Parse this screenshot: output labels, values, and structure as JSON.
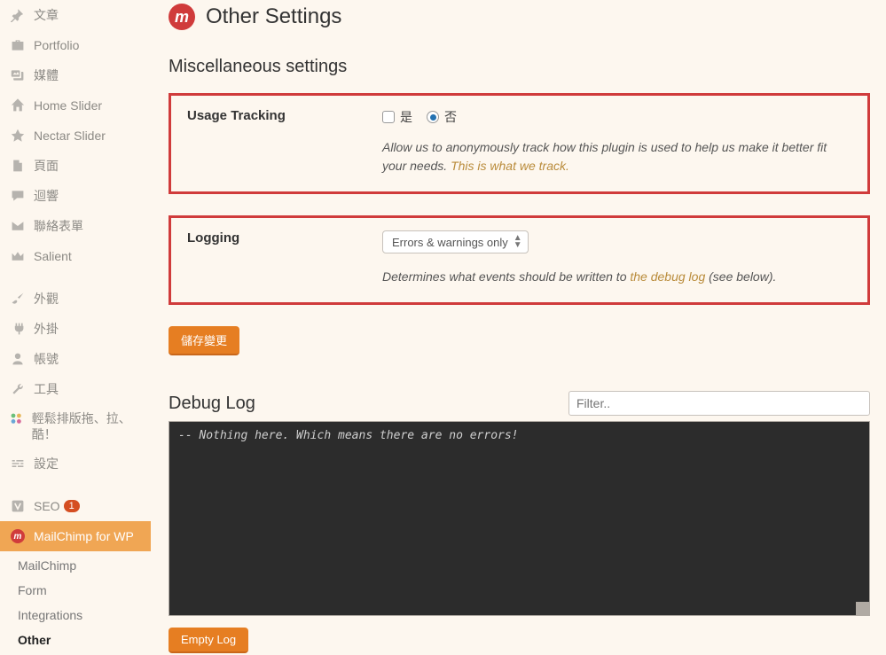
{
  "sidebar": {
    "items": [
      {
        "label": "文章",
        "icon": "pin"
      },
      {
        "label": "Portfolio",
        "icon": "briefcase"
      },
      {
        "label": "媒體",
        "icon": "media"
      },
      {
        "label": "Home Slider",
        "icon": "home"
      },
      {
        "label": "Nectar Slider",
        "icon": "star"
      },
      {
        "label": "頁面",
        "icon": "page"
      },
      {
        "label": "迴響",
        "icon": "comment"
      },
      {
        "label": "聯絡表單",
        "icon": "mail"
      },
      {
        "label": "Salient",
        "icon": "crown"
      }
    ],
    "items2": [
      {
        "label": "外觀",
        "icon": "brush"
      },
      {
        "label": "外掛",
        "icon": "plug"
      },
      {
        "label": "帳號",
        "icon": "user"
      },
      {
        "label": "工具",
        "icon": "wrench"
      },
      {
        "label": "輕鬆排版拖、拉、酷！",
        "icon": "palette"
      },
      {
        "label": "設定",
        "icon": "sliders"
      }
    ],
    "seo": {
      "label": "SEO",
      "badge": "1"
    },
    "mailchimp": {
      "label": "MailChimp for WP"
    },
    "submenu": [
      {
        "label": "MailChimp"
      },
      {
        "label": "Form"
      },
      {
        "label": "Integrations"
      },
      {
        "label": "Other",
        "current": true
      }
    ]
  },
  "header": {
    "title": "Other Settings"
  },
  "misc": {
    "heading": "Miscellaneous settings",
    "usage": {
      "label": "Usage Tracking",
      "yes": "是",
      "no": "否",
      "desc_pre": "Allow us to anonymously track how this plugin is used to help us make it better fit your needs. ",
      "desc_link": "This is what we track."
    },
    "logging": {
      "label": "Logging",
      "selected": "Errors & warnings only",
      "desc_pre": "Determines what events should be written to ",
      "desc_link": "the debug log",
      "desc_post": " (see below)."
    },
    "save_btn": "儲存變更"
  },
  "debug": {
    "heading": "Debug Log",
    "filter_placeholder": "Filter..",
    "log_content": "-- Nothing here. Which means there are no errors!",
    "empty_btn": "Empty Log"
  }
}
